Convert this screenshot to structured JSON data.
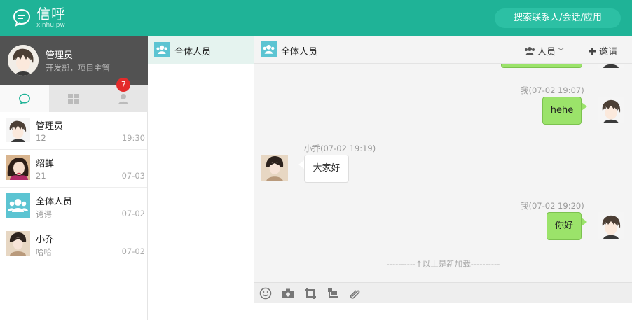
{
  "app": {
    "title": "信呼",
    "subtitle": "xinhu.pw",
    "search_placeholder": "搜索联系人/会话/应用",
    "brand_color": "#1fb397"
  },
  "user": {
    "name": "管理员",
    "title": "开发部，项目主管"
  },
  "tabs": [
    {
      "icon": "chat-bubble-icon"
    },
    {
      "icon": "apps-grid-icon",
      "badge": "7"
    },
    {
      "icon": "person-icon"
    }
  ],
  "conversations": [
    {
      "name": "管理员",
      "last": "12",
      "time": "19:30"
    },
    {
      "name": "貂蝉",
      "last": "21",
      "time": "07-03"
    },
    {
      "name": "全体人员",
      "last": "谔谔",
      "time": "07-02"
    },
    {
      "name": "小乔",
      "last": "哈哈",
      "time": "07-02"
    }
  ],
  "member_panel": {
    "title": "全体人员"
  },
  "chat": {
    "title": "全体人员",
    "people_label": "人员",
    "invite_label": "邀请",
    "messages": [
      {
        "meta": "我(07-02 19:07)",
        "text": "hehe"
      },
      {
        "meta": "小乔(07-02 19:19)",
        "text": "大家好"
      },
      {
        "meta": "我(07-02 19:20)",
        "text": "你好"
      }
    ],
    "divider": "----------↑以上是新加载----------"
  },
  "toolbar": [
    "emoji-icon",
    "image-icon",
    "crop-icon",
    "screenshot-icon",
    "attachment-icon"
  ]
}
